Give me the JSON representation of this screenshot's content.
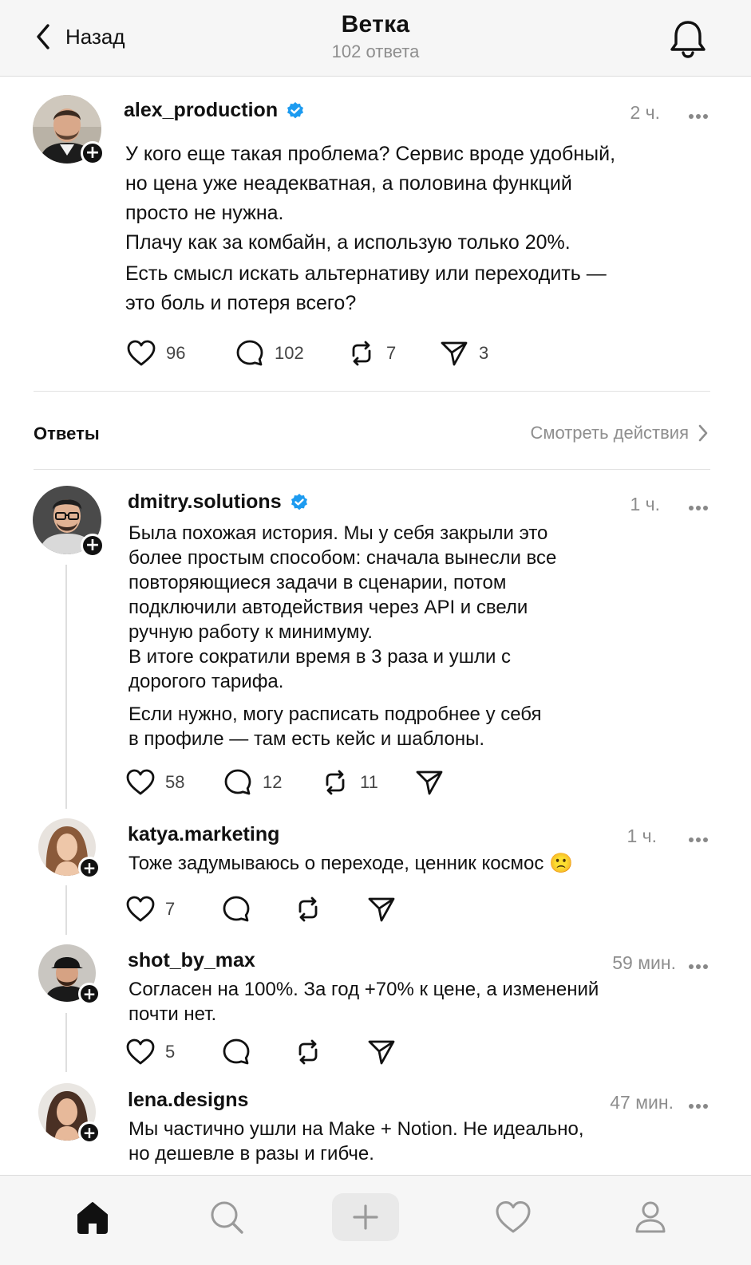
{
  "header": {
    "back_label": "Назад",
    "title": "Ветка",
    "subtitle": "102 ответа"
  },
  "post": {
    "username": "alex_production",
    "verified": true,
    "time": "2 ч.",
    "lines": [
      "У кого еще такая проблема? Сервис вроде удобный,",
      "но цена уже неадекватная, а половина функций",
      "просто не нужна.",
      "Плачу как за комбайн, а использую только 20%.",
      "Есть смысл искать альтернативу или переходить —",
      "это боль и потеря всего?"
    ],
    "likes": "96",
    "comments": "102",
    "reposts": "7",
    "shares": "3"
  },
  "answers": {
    "label": "Ответы",
    "see_actions": "Смотреть действия"
  },
  "replies": [
    {
      "username": "dmitry.solutions",
      "verified": true,
      "time": "1 ч.",
      "lines": [
        "Была похожая история. Мы у себя закрыли это",
        "более простым способом: сначала вынесли все",
        "повторяющиеся задачи в сценарии, потом",
        "подключили автодействия через API и свели",
        "ручную работу к минимуму.",
        "В итоге сократили время в 3 раза и ушли с",
        "дорогого тарифа.",
        "Если нужно, могу расписать подробнее у себя",
        "в профиле — там есть кейс и шаблоны."
      ],
      "likes": "58",
      "comments": "12",
      "reposts": "11",
      "shares": ""
    },
    {
      "username": "katya.marketing",
      "verified": false,
      "time": "1 ч.",
      "lines": [
        "Тоже задумываюсь о переходе, ценник космос 🙁"
      ],
      "likes": "7",
      "comments": "",
      "reposts": "",
      "shares": ""
    },
    {
      "username": "shot_by_max",
      "verified": false,
      "time": "59 мин.",
      "lines": [
        "Согласен на 100%. За год +70% к цене, а изменений",
        "почти нет."
      ],
      "likes": "5",
      "comments": "",
      "reposts": "",
      "shares": ""
    },
    {
      "username": "lena.designs",
      "verified": false,
      "time": "47 мин.",
      "lines": [
        "Мы частично ушли на Make + Notion. Не идеально,",
        "но дешевле в разы и гибче."
      ]
    }
  ],
  "bottom_nav": {
    "items": [
      "home-icon",
      "search-icon",
      "plus-icon",
      "heart-icon",
      "profile-icon"
    ],
    "active": "home-icon"
  },
  "colors": {
    "verified": "#1d9bf0",
    "text": "#111111",
    "muted": "#8e8e8e"
  }
}
